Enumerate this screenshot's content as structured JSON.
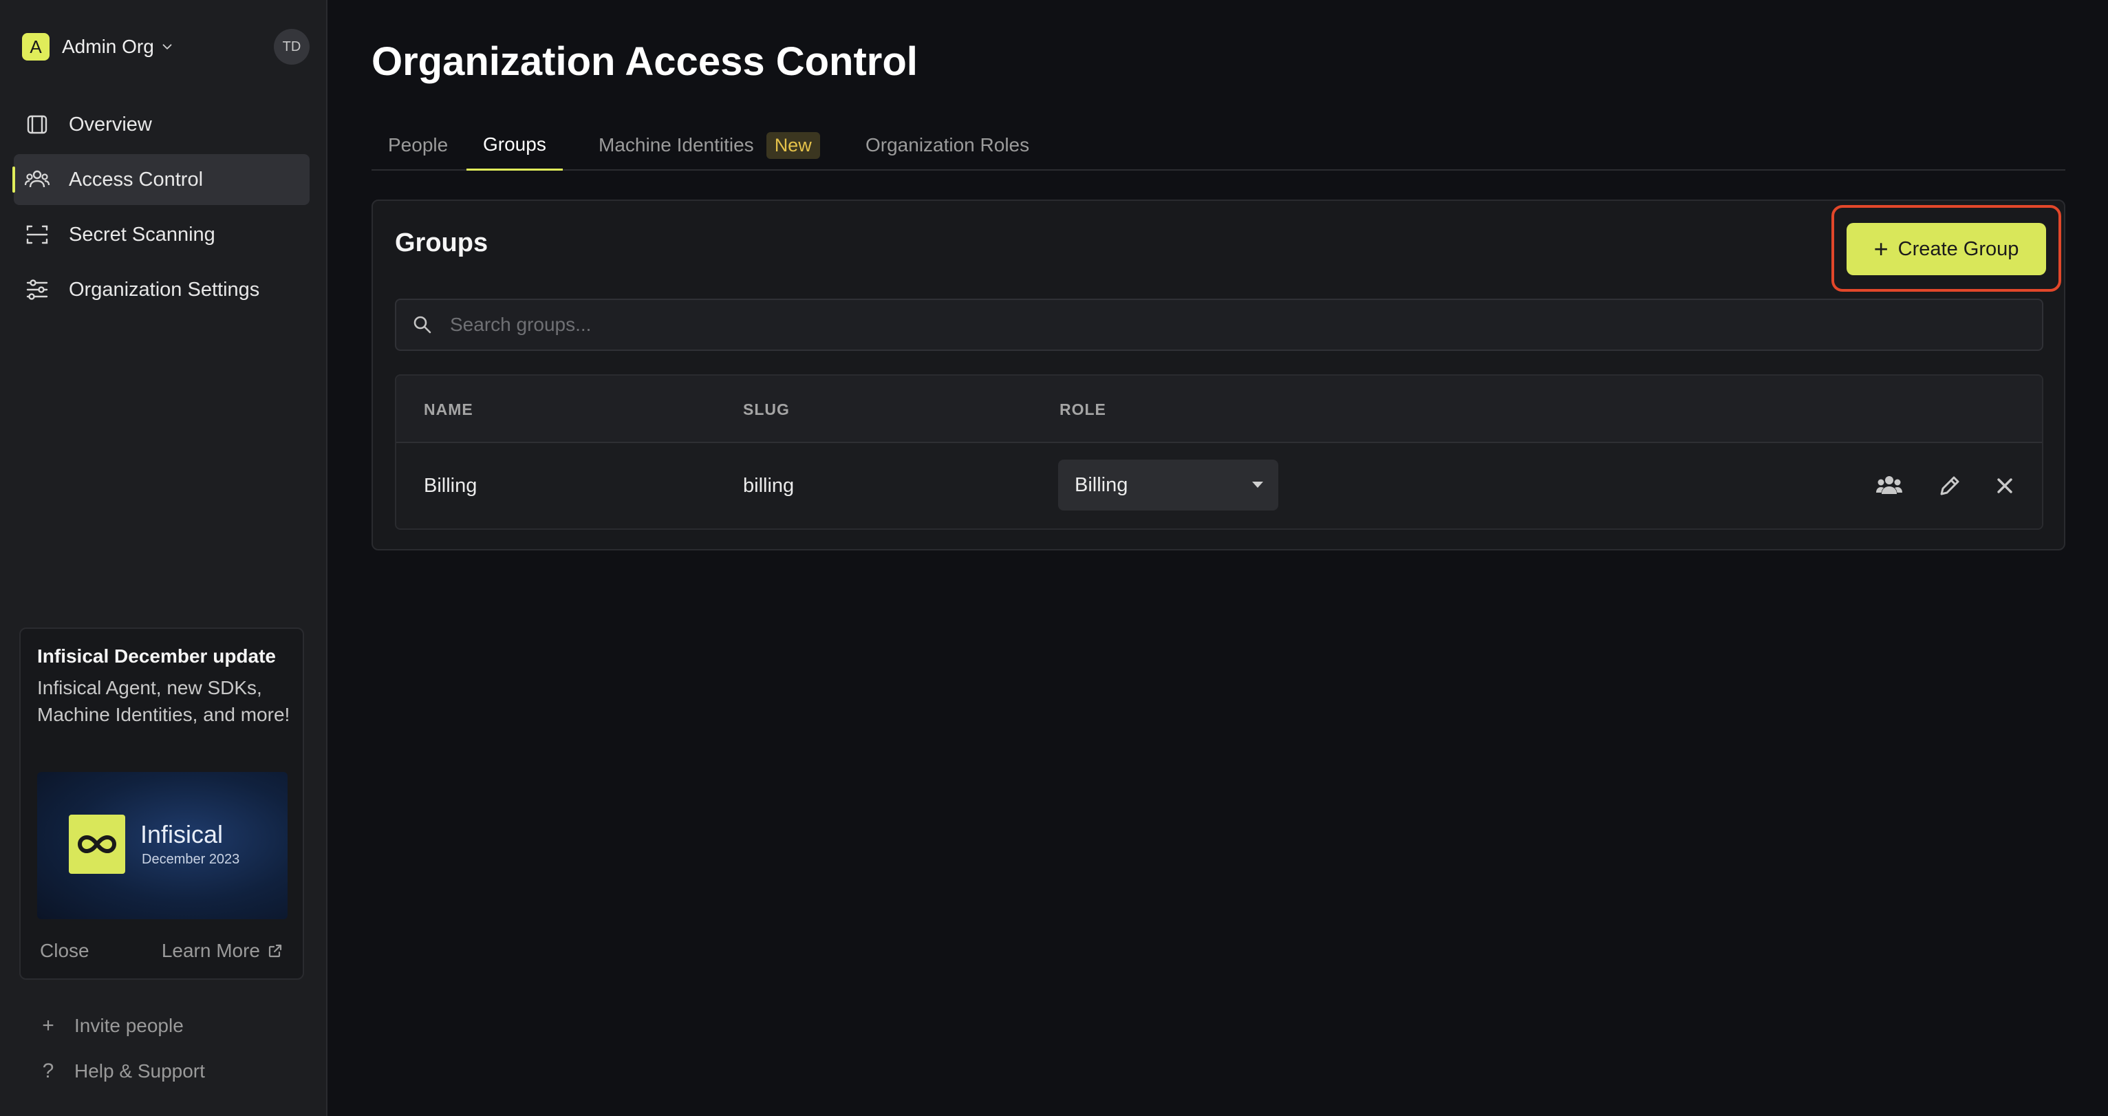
{
  "sidebar": {
    "org_initial": "A",
    "org_name": "Admin Org",
    "user_initials": "TD",
    "nav": [
      {
        "label": "Overview",
        "icon": "overview-icon"
      },
      {
        "label": "Access Control",
        "icon": "users-icon",
        "active": true
      },
      {
        "label": "Secret Scanning",
        "icon": "scan-icon"
      },
      {
        "label": "Organization Settings",
        "icon": "sliders-icon"
      }
    ],
    "promo": {
      "title": "Infisical December update",
      "description": "Infisical Agent, new SDKs, Machine Identities, and more!",
      "image_brand": "Infisical",
      "image_date": "December 2023",
      "close_label": "Close",
      "learn_more_label": "Learn More"
    },
    "invite_label": "Invite people",
    "help_label": "Help & Support"
  },
  "page": {
    "title": "Organization Access Control",
    "tabs": [
      {
        "label": "People"
      },
      {
        "label": "Groups",
        "active": true
      },
      {
        "label": "Machine Identities",
        "badge": "New"
      },
      {
        "label": "Organization Roles"
      }
    ]
  },
  "groups_card": {
    "title": "Groups",
    "create_button_label": "Create Group",
    "search_placeholder": "Search groups...",
    "columns": [
      "NAME",
      "SLUG",
      "ROLE"
    ],
    "rows": [
      {
        "name": "Billing",
        "slug": "billing",
        "role": "Billing"
      }
    ]
  },
  "colors": {
    "accent": "#e0ed5a",
    "highlight_outline": "#e2472a",
    "background": "#0f1014",
    "sidebar": "#1d1e21"
  }
}
